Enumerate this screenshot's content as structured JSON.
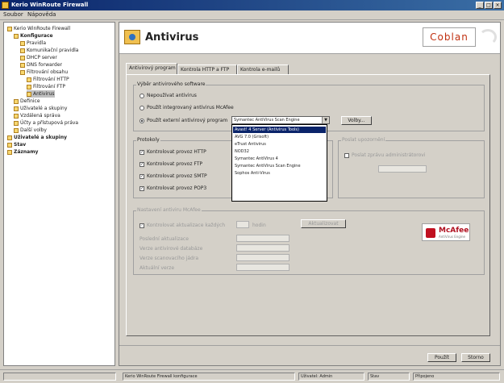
{
  "window": {
    "title": "Kerio WinRoute Firewall"
  },
  "menu": [
    "Soubor",
    "Nápověda"
  ],
  "tree": [
    {
      "label": "Kerio WinRoute Firewall",
      "level": 0,
      "bold": false
    },
    {
      "label": "Konfigurace",
      "level": 1,
      "bold": true
    },
    {
      "label": "Pravidla",
      "level": 2
    },
    {
      "label": "Komunikační pravidla",
      "level": 2
    },
    {
      "label": "DHCP server",
      "level": 2
    },
    {
      "label": "DNS forwarder",
      "level": 2
    },
    {
      "label": "Filtrování obsahu",
      "level": 2
    },
    {
      "label": "Filtrování HTTP",
      "level": 3
    },
    {
      "label": "Filtrování FTP",
      "level": 3
    },
    {
      "label": "Antivirus",
      "level": 3,
      "selected": true
    },
    {
      "label": "Definice",
      "level": 1
    },
    {
      "label": "Uživatelé a skupiny",
      "level": 1
    },
    {
      "label": "Vzdálená správa",
      "level": 1
    },
    {
      "label": "Účty a přístupová práva",
      "level": 1
    },
    {
      "label": "Další volby",
      "level": 1
    },
    {
      "label": "Uživatelé a skupiny",
      "level": 0,
      "bold": true
    },
    {
      "label": "Stav",
      "level": 0,
      "bold": true
    },
    {
      "label": "Záznamy",
      "level": 0,
      "bold": true
    }
  ],
  "header": {
    "title": "Antivirus",
    "logo": "Coblan"
  },
  "tabs": [
    "Antivirový program",
    "Kontrola HTTP a FTP",
    "Kontrola e-mailů"
  ],
  "antivirus": {
    "group_label": "Výběr antivirového software",
    "opt_none": "Nepoužívat antivirus",
    "opt_integrated": "Použít integrovaný antivirus McAfee",
    "opt_external": "Použít externí antivirový program",
    "selected_program": "Symantec AntiVirus Scan Engine",
    "options_button": "Volby..."
  },
  "dropdown": [
    "Avast! 4 Server (Antivirus Tools)",
    "AVG 7.0 (Grisoft)",
    "eTrust Antivirus",
    "NOD32",
    "Symantec AntiVirus 4",
    "Symantec AntiVirus Scan Engine",
    "Sophos Anti-Virus"
  ],
  "protocols": {
    "label": "Protokoly",
    "items": [
      "Kontrolovat provoz HTTP",
      "Kontrolovat provoz FTP",
      "Kontrolovat provoz SMTP",
      "Kontrolovat provoz POP3"
    ],
    "right_label": "Poslat upozornění",
    "right_text": "Poslat zprávu administrátorovi"
  },
  "mcafee_settings": {
    "label": "Nastavení antiviru McAfee",
    "check": "Kontrolovat aktualizace každých",
    "unit": "hodin",
    "update_button": "Aktualizovat",
    "rows": [
      "Poslední aktualizace",
      "Verze antivirové databáze",
      "Verze scanovacího jádra",
      "Aktuální verze"
    ],
    "values": [
      "",
      "",
      "",
      ""
    ]
  },
  "mcafee_logo": {
    "title": "McAfee",
    "subtitle": "AntiVirus Engine"
  },
  "buttons": {
    "ok": "Použít",
    "cancel": "Storno"
  },
  "status": {
    "left": "",
    "main": "Kerio WinRoute Firewall konfigurace",
    "s1": "Uživatel: Admin",
    "s2": "Stav",
    "s3": "Připojeno"
  }
}
